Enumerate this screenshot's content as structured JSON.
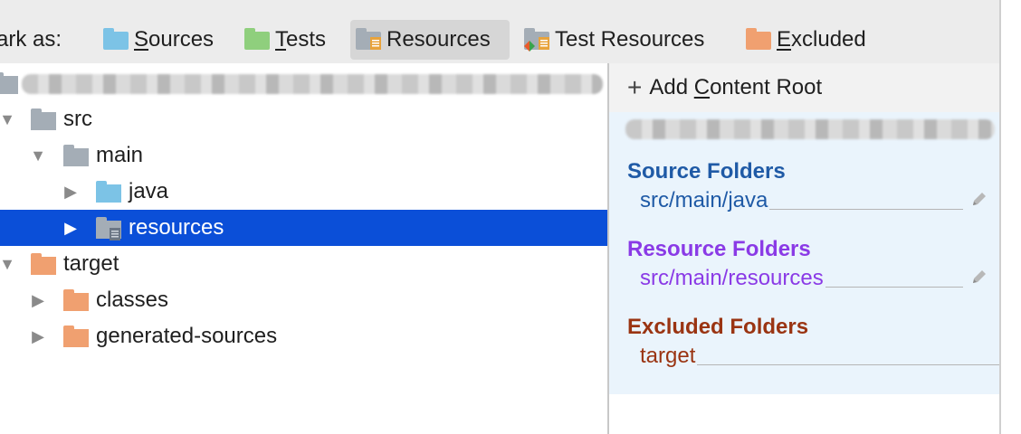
{
  "toolbar": {
    "mark_label": "ark as:",
    "buttons": [
      {
        "pre": "",
        "ul": "S",
        "post": "ources",
        "icon": "sources-folder-icon",
        "color": "#7cc3e6"
      },
      {
        "pre": "",
        "ul": "T",
        "post": "ests",
        "icon": "tests-folder-icon",
        "color": "#8fcf7d"
      },
      {
        "pre": "",
        "ul": "",
        "post": "Resources",
        "icon": "resources-folder-icon",
        "color": "#a4adb6"
      },
      {
        "pre": "",
        "ul": "",
        "post": "Test Resources",
        "icon": "test-resources-folder-icon",
        "color": "#a4adb6"
      },
      {
        "pre": "",
        "ul": "E",
        "post": "xcluded",
        "icon": "excluded-folder-icon",
        "color": "#f0a070"
      }
    ]
  },
  "tree": {
    "rows": [
      {
        "label": "src",
        "arrow": "▼",
        "folder_color": "#a4adb6"
      },
      {
        "label": "main",
        "arrow": "▼",
        "folder_color": "#a4adb6"
      },
      {
        "label": "java",
        "arrow": "▶",
        "folder_color": "#7cc3e6"
      },
      {
        "label": "resources",
        "arrow": "▶",
        "folder_color": "#a4adb6",
        "selected": true
      },
      {
        "label": "target",
        "arrow": "▼",
        "folder_color": "#f0a070"
      },
      {
        "label": "classes",
        "arrow": "▶",
        "folder_color": "#f0a070"
      },
      {
        "label": "generated-sources",
        "arrow": "▶",
        "folder_color": "#f0a070"
      }
    ]
  },
  "panel": {
    "add_root_pre": "Add ",
    "add_root_ul": "C",
    "add_root_post": "ontent Root",
    "sections": [
      {
        "title": "Source Folders",
        "path": "src/main/java",
        "color": "#1f5aa6"
      },
      {
        "title": "Resource Folders",
        "path": "src/main/resources",
        "color": "#8a3ae6"
      },
      {
        "title": "Excluded Folders",
        "path": "target",
        "color": "#9a3412"
      }
    ]
  },
  "colors": {
    "selection": "#0b4fd8",
    "panel_bg": "#eaf4fc",
    "toolbar_bg": "#ececec"
  }
}
